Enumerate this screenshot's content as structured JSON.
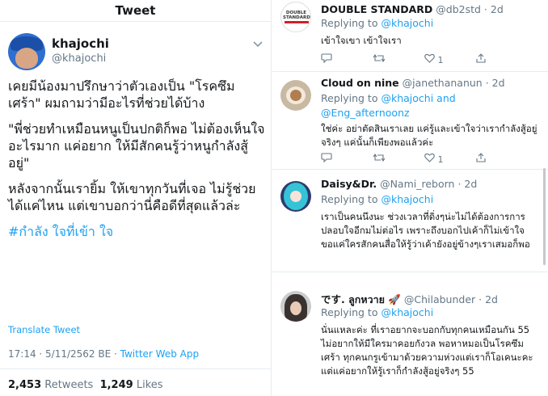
{
  "left": {
    "header_title": "Tweet",
    "author": {
      "name": "khajochi",
      "handle": "@khajochi"
    },
    "body": [
      "เคยมีน้องมาปรึกษาว่าตัวเองเป็น \"โรคซึมเศร้า\" ผมถามว่ามีอะไรที่ช่วยได้บ้าง",
      "\"พี่ช่วยทำเหมือนหนูเป็นปกติก็พอ ไม่ต้องเห็นใจอะไรมาก แค่อยาก ให้มีสักคนรู้ว่าหนูกำลังสู้อยู่\"",
      "หลังจากนั้นเรายิ้ม ให้เขาทุกวันที่เจอ ไม่รู้ช่วยได้แค่ไหน แต่เขาบอกว่านี่คือดีที่สุดแล้วล่ะ"
    ],
    "hashtag": "#กำลัง ใจที่เข้า ใจ",
    "translate": "Translate Tweet",
    "meta_time": "17:14 · 5/11/2562 BE · ",
    "meta_source": "Twitter Web App",
    "retweets": "2,453",
    "retweets_label": "Retweets",
    "likes": "1,249",
    "likes_label": "Likes"
  },
  "replies": [
    {
      "name": "DOUBLE STANDARD",
      "handle": "@db2std",
      "time": "· 2d",
      "replying_to": "Replying to",
      "mentions": [
        "@khajochi"
      ],
      "text": "เข้าใจเขา เข้าใจเรา",
      "avatar_text": "DOUBLE STANDARD",
      "like_count": "1"
    },
    {
      "name": "Cloud on nine",
      "handle": "@janethananun",
      "time": "· 2d",
      "replying_to": "Replying to",
      "mentions": [
        "@khajochi",
        "and",
        "@Eng_afternoonz"
      ],
      "text": "ใช่ค่ะ อย่าตัดสินเราเลย แค่รู้และเข้าใจว่าเรากำลังสู้อยู่จริงๆ แค่นั้นก็เพียงพอแล้วค่ะ",
      "like_count": "1"
    },
    {
      "name": "Daisy&Dr.",
      "handle": "@Nami_reborn",
      "time": "· 2d",
      "replying_to": "Replying to",
      "mentions": [
        "@khajochi"
      ],
      "text": "เราเป็นคนนึงนะ ช่วงเวลาที่ดิ่งๆน่ะไม่ได้ต้องการการปลอบใจอีกมไม่ต่อไร เพราะถึงบอกไปเค้าก็ไม่เข้าใจ ขอแค่ใครสักคนสื่อให้รู้ว่าเค้ายังอยู่ข้างๆเราเสมอก็พอ"
    },
    {
      "name": "です. ลูกหวาย 🚀",
      "handle": "@Chilabunder",
      "time": "· 2d",
      "replying_to": "Replying to",
      "mentions": [
        "@khajochi"
      ],
      "text": "นั่นแหละค่ะ ที่เราอยากจะบอกกับทุกคนเหมือนกัน 55 ไม่อยากให้มีใครมาคอยกังวล พอหาหมอเป็นโรคซึมเศร้า ทุกคนกรูเข้ามาด้วยความห่วงแต่เราก็โอเคนะคะ แต่แค่อยากให้รู้เราก็กำลังสู้อยู่จริงๆ 55"
    }
  ],
  "icons": [
    "chevron-down-icon",
    "reply-icon",
    "retweet-icon",
    "like-icon",
    "share-icon"
  ]
}
